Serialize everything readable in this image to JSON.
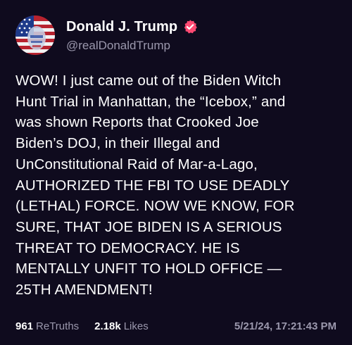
{
  "author": {
    "display_name": "Donald J. Trump",
    "handle": "@realDonaldTrump",
    "verified": true,
    "verified_badge_color": "#ff4a73"
  },
  "post": {
    "text": "WOW! I just came out of the Biden Witch\nHunt Trial in Manhattan, the “Icebox,” and\nwas shown Reports that Crooked Joe\nBiden’s DOJ, in their Illegal and\nUnConstitutional Raid of Mar-a-Lago,\nAUTHORIZED THE FBI TO USE DEADLY\n(LETHAL) FORCE. NOW WE KNOW, FOR\nSURE, THAT JOE BIDEN IS A SERIOUS\nTHREAT TO DEMOCRACY. HE IS\nMENTALLY UNFIT TO HOLD OFFICE —\n25TH AMENDMENT!"
  },
  "stats": {
    "retruths_count": "961",
    "retruths_label": "ReTruths",
    "likes_count": "2.18k",
    "likes_label": "Likes",
    "timestamp": "5/21/24, 17:21:43 PM"
  },
  "colors": {
    "background": "#0f0b1e",
    "primary_text": "#ffffff",
    "secondary_text": "#9b98ad"
  }
}
